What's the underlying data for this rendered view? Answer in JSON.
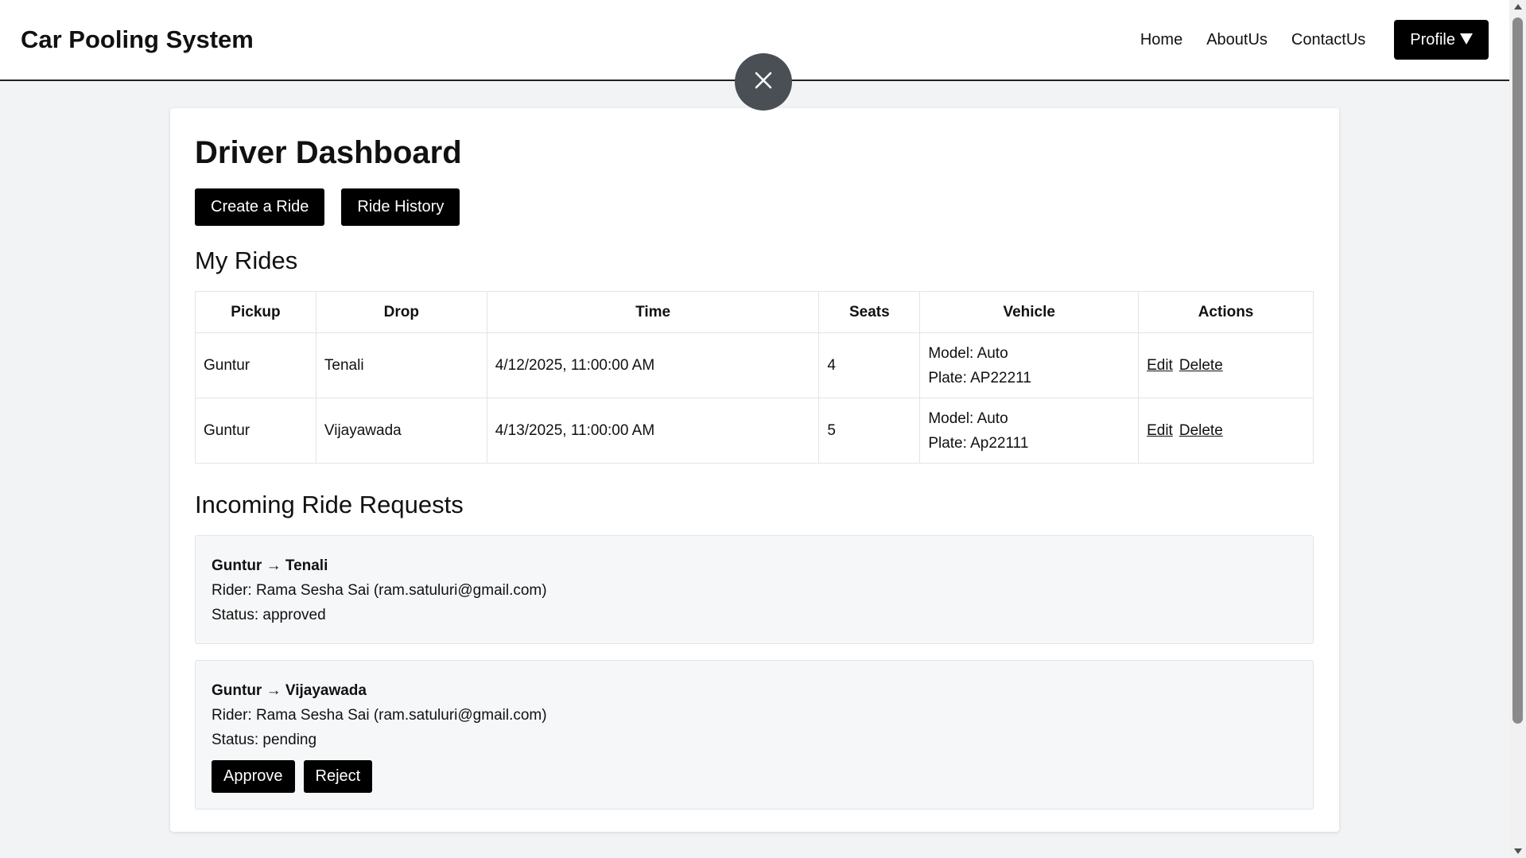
{
  "header": {
    "brand": "Car Pooling System",
    "nav": [
      "Home",
      "AboutUs",
      "ContactUs"
    ],
    "profile_label": "Profile"
  },
  "dashboard": {
    "title": "Driver Dashboard",
    "create_ride_label": "Create a Ride",
    "ride_history_label": "Ride History",
    "my_rides_title": "My Rides",
    "columns": [
      "Pickup",
      "Drop",
      "Time",
      "Seats",
      "Vehicle",
      "Actions"
    ],
    "rides": [
      {
        "pickup": "Guntur",
        "drop": "Tenali",
        "time": "4/12/2025, 11:00:00 AM",
        "seats": "4",
        "model": "Model: Auto",
        "plate": "Plate: AP22211",
        "edit": "Edit",
        "delete": "Delete"
      },
      {
        "pickup": "Guntur",
        "drop": "Vijayawada",
        "time": "4/13/2025, 11:00:00 AM",
        "seats": "5",
        "model": "Model: Auto",
        "plate": "Plate: Ap22111",
        "edit": "Edit",
        "delete": "Delete"
      }
    ],
    "requests_title": "Incoming Ride Requests",
    "requests": [
      {
        "route": "Guntur → Tenali",
        "rider": "Rider: Rama Sesha Sai (ram.satuluri@gmail.com)",
        "status": "Status: approved"
      },
      {
        "route": "Guntur → Vijayawada",
        "rider": "Rider: Rama Sesha Sai (ram.satuluri@gmail.com)",
        "status": "Status: pending",
        "approve_label": "Approve",
        "reject_label": "Reject"
      }
    ]
  },
  "icons": {
    "close": "close-icon",
    "caret": "caret-down-icon"
  },
  "colors": {
    "button_bg": "#000000",
    "page_bg": "#f2f3f5",
    "fab_bg": "#4a4f55"
  }
}
